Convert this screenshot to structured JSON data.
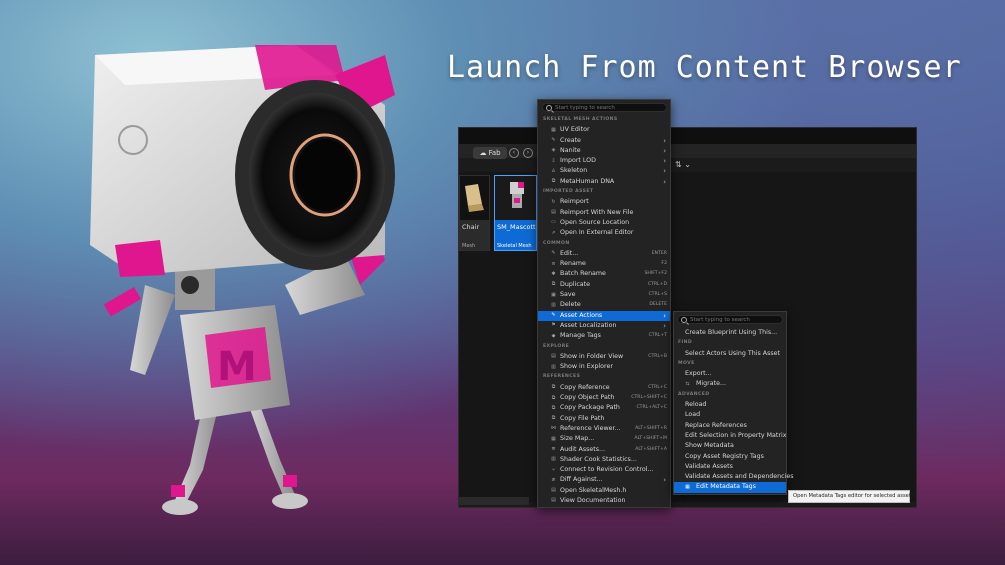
{
  "headline": "Launch From Content Browser",
  "content_browser": {
    "fab_label": "Fab",
    "tiles": [
      {
        "name": "Chair",
        "type": "Mesh"
      },
      {
        "name": "SM_Mascott",
        "type": "Skeletal Mesh"
      }
    ]
  },
  "context_menu": {
    "search_placeholder": "Start typing to search",
    "sections": {
      "skeletal": "SKELETAL MESH ACTIONS",
      "imported": "IMPORTED ASSET",
      "common": "COMMON",
      "explore": "EXPLORE",
      "references": "REFERENCES"
    },
    "items": {
      "uv_editor": "UV Editor",
      "create": "Create",
      "nanite": "Nanite",
      "import_lod": "Import LOD",
      "skeleton": "Skeleton",
      "metahuman_dna": "MetaHuman DNA",
      "reimport": "Reimport",
      "reimport_new": "Reimport With New File",
      "open_source": "Open Source Location",
      "open_external": "Open In External Editor",
      "edit": "Edit...",
      "edit_sc": "ENTER",
      "rename": "Rename",
      "rename_sc": "F2",
      "batch_rename": "Batch Rename",
      "batch_rename_sc": "SHIFT+F2",
      "duplicate": "Duplicate",
      "duplicate_sc": "CTRL+D",
      "save": "Save",
      "save_sc": "CTRL+S",
      "delete": "Delete",
      "delete_sc": "DELETE",
      "asset_actions": "Asset Actions",
      "asset_localization": "Asset Localization",
      "manage_tags": "Manage Tags",
      "manage_tags_sc": "CTRL+T",
      "show_folder": "Show in Folder View",
      "show_folder_sc": "CTRL+B",
      "show_explorer": "Show in Explorer",
      "copy_reference": "Copy Reference",
      "copy_reference_sc": "CTRL+C",
      "copy_object_path": "Copy Object Path",
      "copy_object_path_sc": "CTRL+SHIFT+C",
      "copy_package_path": "Copy Package Path",
      "copy_package_path_sc": "CTRL+ALT+C",
      "copy_file_path": "Copy File Path",
      "reference_viewer": "Reference Viewer...",
      "reference_viewer_sc": "ALT+SHIFT+R",
      "size_map": "Size Map...",
      "size_map_sc": "ALT+SHIFT+M",
      "audit_assets": "Audit Assets...",
      "audit_assets_sc": "ALT+SHIFT+A",
      "shader_cook": "Shader Cook Statistics...",
      "connect_rc": "Connect to Revision Control...",
      "diff_against": "Diff Against...",
      "open_header": "Open SkeletalMesh.h",
      "view_docs": "View Documentation"
    }
  },
  "submenu": {
    "search_placeholder": "Start typing to search",
    "create_blueprint": "Create Blueprint Using This...",
    "sections": {
      "find": "FIND",
      "move": "MOVE",
      "advanced": "ADVANCED"
    },
    "select_actors": "Select Actors Using This Asset",
    "export": "Export...",
    "migrate": "Migrate...",
    "reload": "Reload",
    "load": "Load",
    "replace_refs": "Replace References",
    "edit_selection": "Edit Selection in Property Matrix",
    "show_metadata": "Show Metadata",
    "copy_registry_tags": "Copy Asset Registry Tags",
    "validate_assets": "Validate Assets",
    "validate_deps": "Validate Assets and Dependencies",
    "edit_metadata_tags": "Edit Metadata Tags"
  },
  "tooltip": "Open Metadata Tags editor for selected asset.",
  "colors": {
    "highlight": "#0e6bd6",
    "menu_bg": "#232323",
    "accent_magenta": "#e0168f"
  }
}
